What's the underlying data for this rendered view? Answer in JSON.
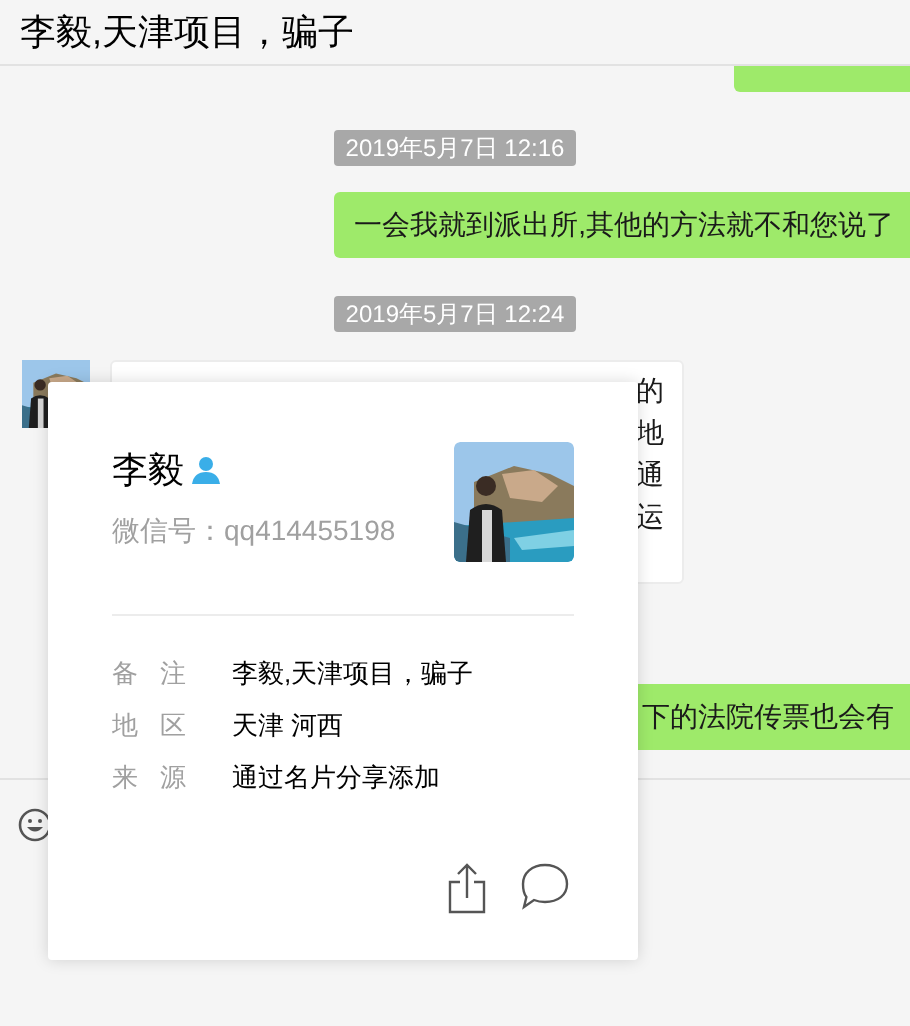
{
  "chat": {
    "title": "李毅,天津项目，骗子",
    "messages": [
      {
        "kind": "outgoing"
      },
      {
        "kind": "time",
        "text": "2019年5月7日 12:16"
      },
      {
        "kind": "outgoing",
        "text": "一会我就到派出所,其他的方法就不和您说了"
      },
      {
        "kind": "time",
        "text": "2019年5月7日 12:24"
      },
      {
        "kind": "incoming",
        "lines": [
          "的",
          "地",
          "通",
          "运"
        ]
      },
      {
        "kind": "outgoing",
        "text": "下的法院传票也会有"
      }
    ]
  },
  "profile_card": {
    "name": "李毅",
    "wechat_id": "微信号：qq414455198",
    "fields": [
      {
        "label": "备注",
        "value": "李毅,天津项目，骗子"
      },
      {
        "label": "地区",
        "value": "天津 河西"
      },
      {
        "label": "来源",
        "value": "通过名片分享添加"
      }
    ]
  }
}
